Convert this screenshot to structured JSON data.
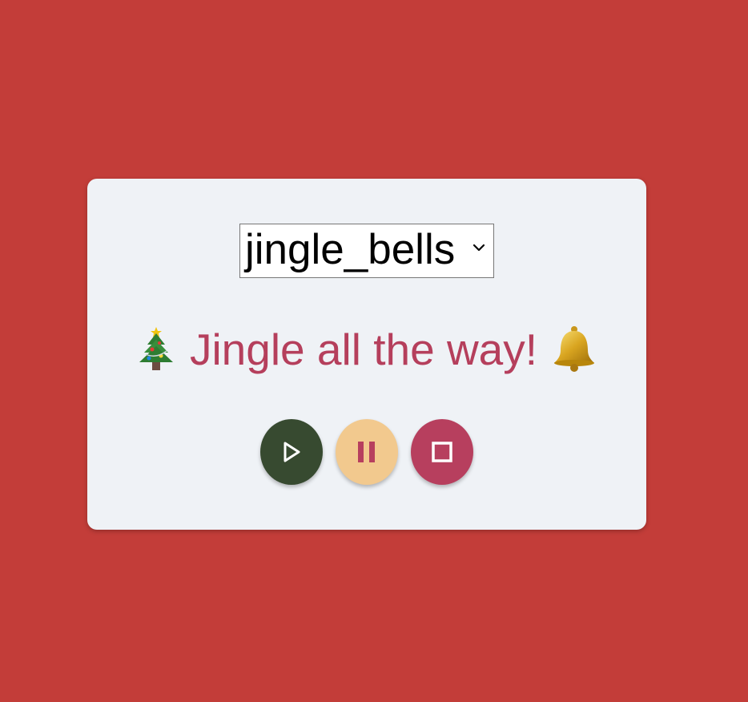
{
  "song_select": {
    "selected": "jingle_bells",
    "icon": "chevron-down-icon"
  },
  "message": {
    "leading_emoji": "tree-icon",
    "text": "Jingle all the way!",
    "trailing_emoji": "bell-icon"
  },
  "controls": {
    "play": {
      "icon": "play-icon",
      "color": "#374a30"
    },
    "pause": {
      "icon": "pause-icon",
      "color": "#f2c98e"
    },
    "stop": {
      "icon": "stop-icon",
      "color": "#b73f5e"
    }
  },
  "colors": {
    "background": "#c33d39",
    "card": "#eff2f6",
    "message_text": "#b53f5c"
  }
}
